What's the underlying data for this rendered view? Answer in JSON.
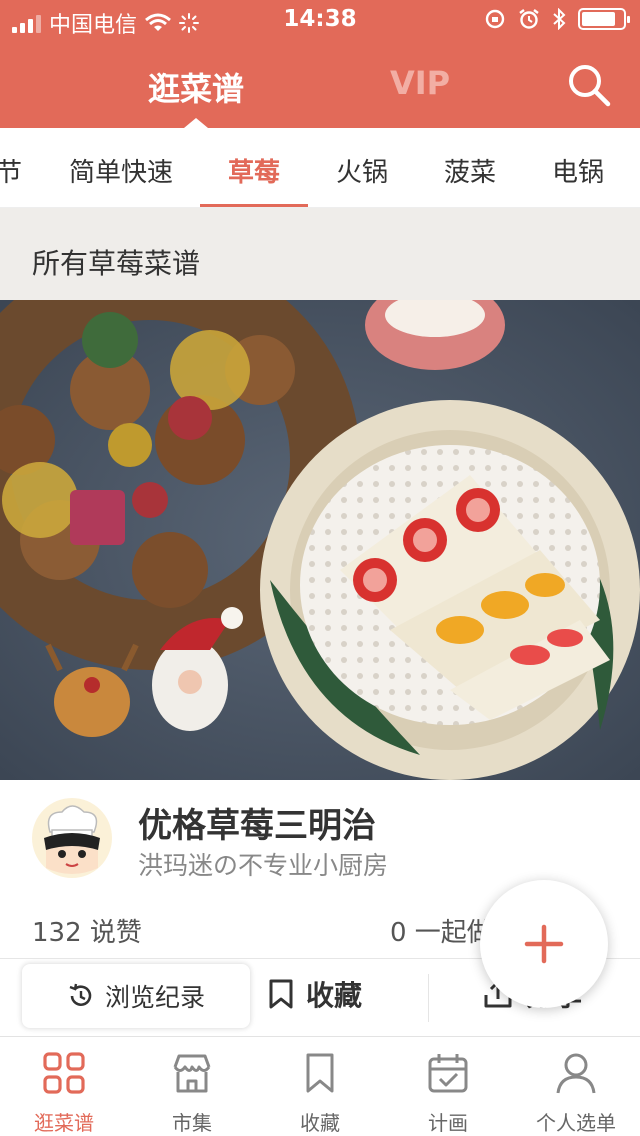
{
  "status_bar": {
    "carrier": "中国电信",
    "time": "14:38"
  },
  "header": {
    "tabs": [
      {
        "label": "逛菜谱",
        "active": true
      },
      {
        "label": "VIP",
        "active": false
      }
    ],
    "search_icon": "search-icon"
  },
  "categories": {
    "items": [
      "节",
      "简单快速",
      "草莓",
      "火锅",
      "菠菜",
      "电锅"
    ],
    "selected": "草莓"
  },
  "section": {
    "title": "所有草莓菜谱"
  },
  "recipe": {
    "title": "优格草莓三明治",
    "author": "洪玛迷の不专业小厨房",
    "likes_text": "132 说赞",
    "together_text": "0 一起做"
  },
  "actions": {
    "history_label": "浏览纪录",
    "collect_label": "收藏",
    "share_label": "分享"
  },
  "bottom_nav": [
    {
      "label": "逛菜谱",
      "icon": "grid-icon",
      "active": true
    },
    {
      "label": "市集",
      "icon": "store-icon",
      "active": false
    },
    {
      "label": "收藏",
      "icon": "bookmark-icon",
      "active": false
    },
    {
      "label": "计画",
      "icon": "calendar-check-icon",
      "active": false
    },
    {
      "label": "个人选单",
      "icon": "person-icon",
      "active": false
    }
  ],
  "colors": {
    "brand": "#e26a59",
    "vip_text": "#f2aea4",
    "section_bg": "#efedea"
  }
}
